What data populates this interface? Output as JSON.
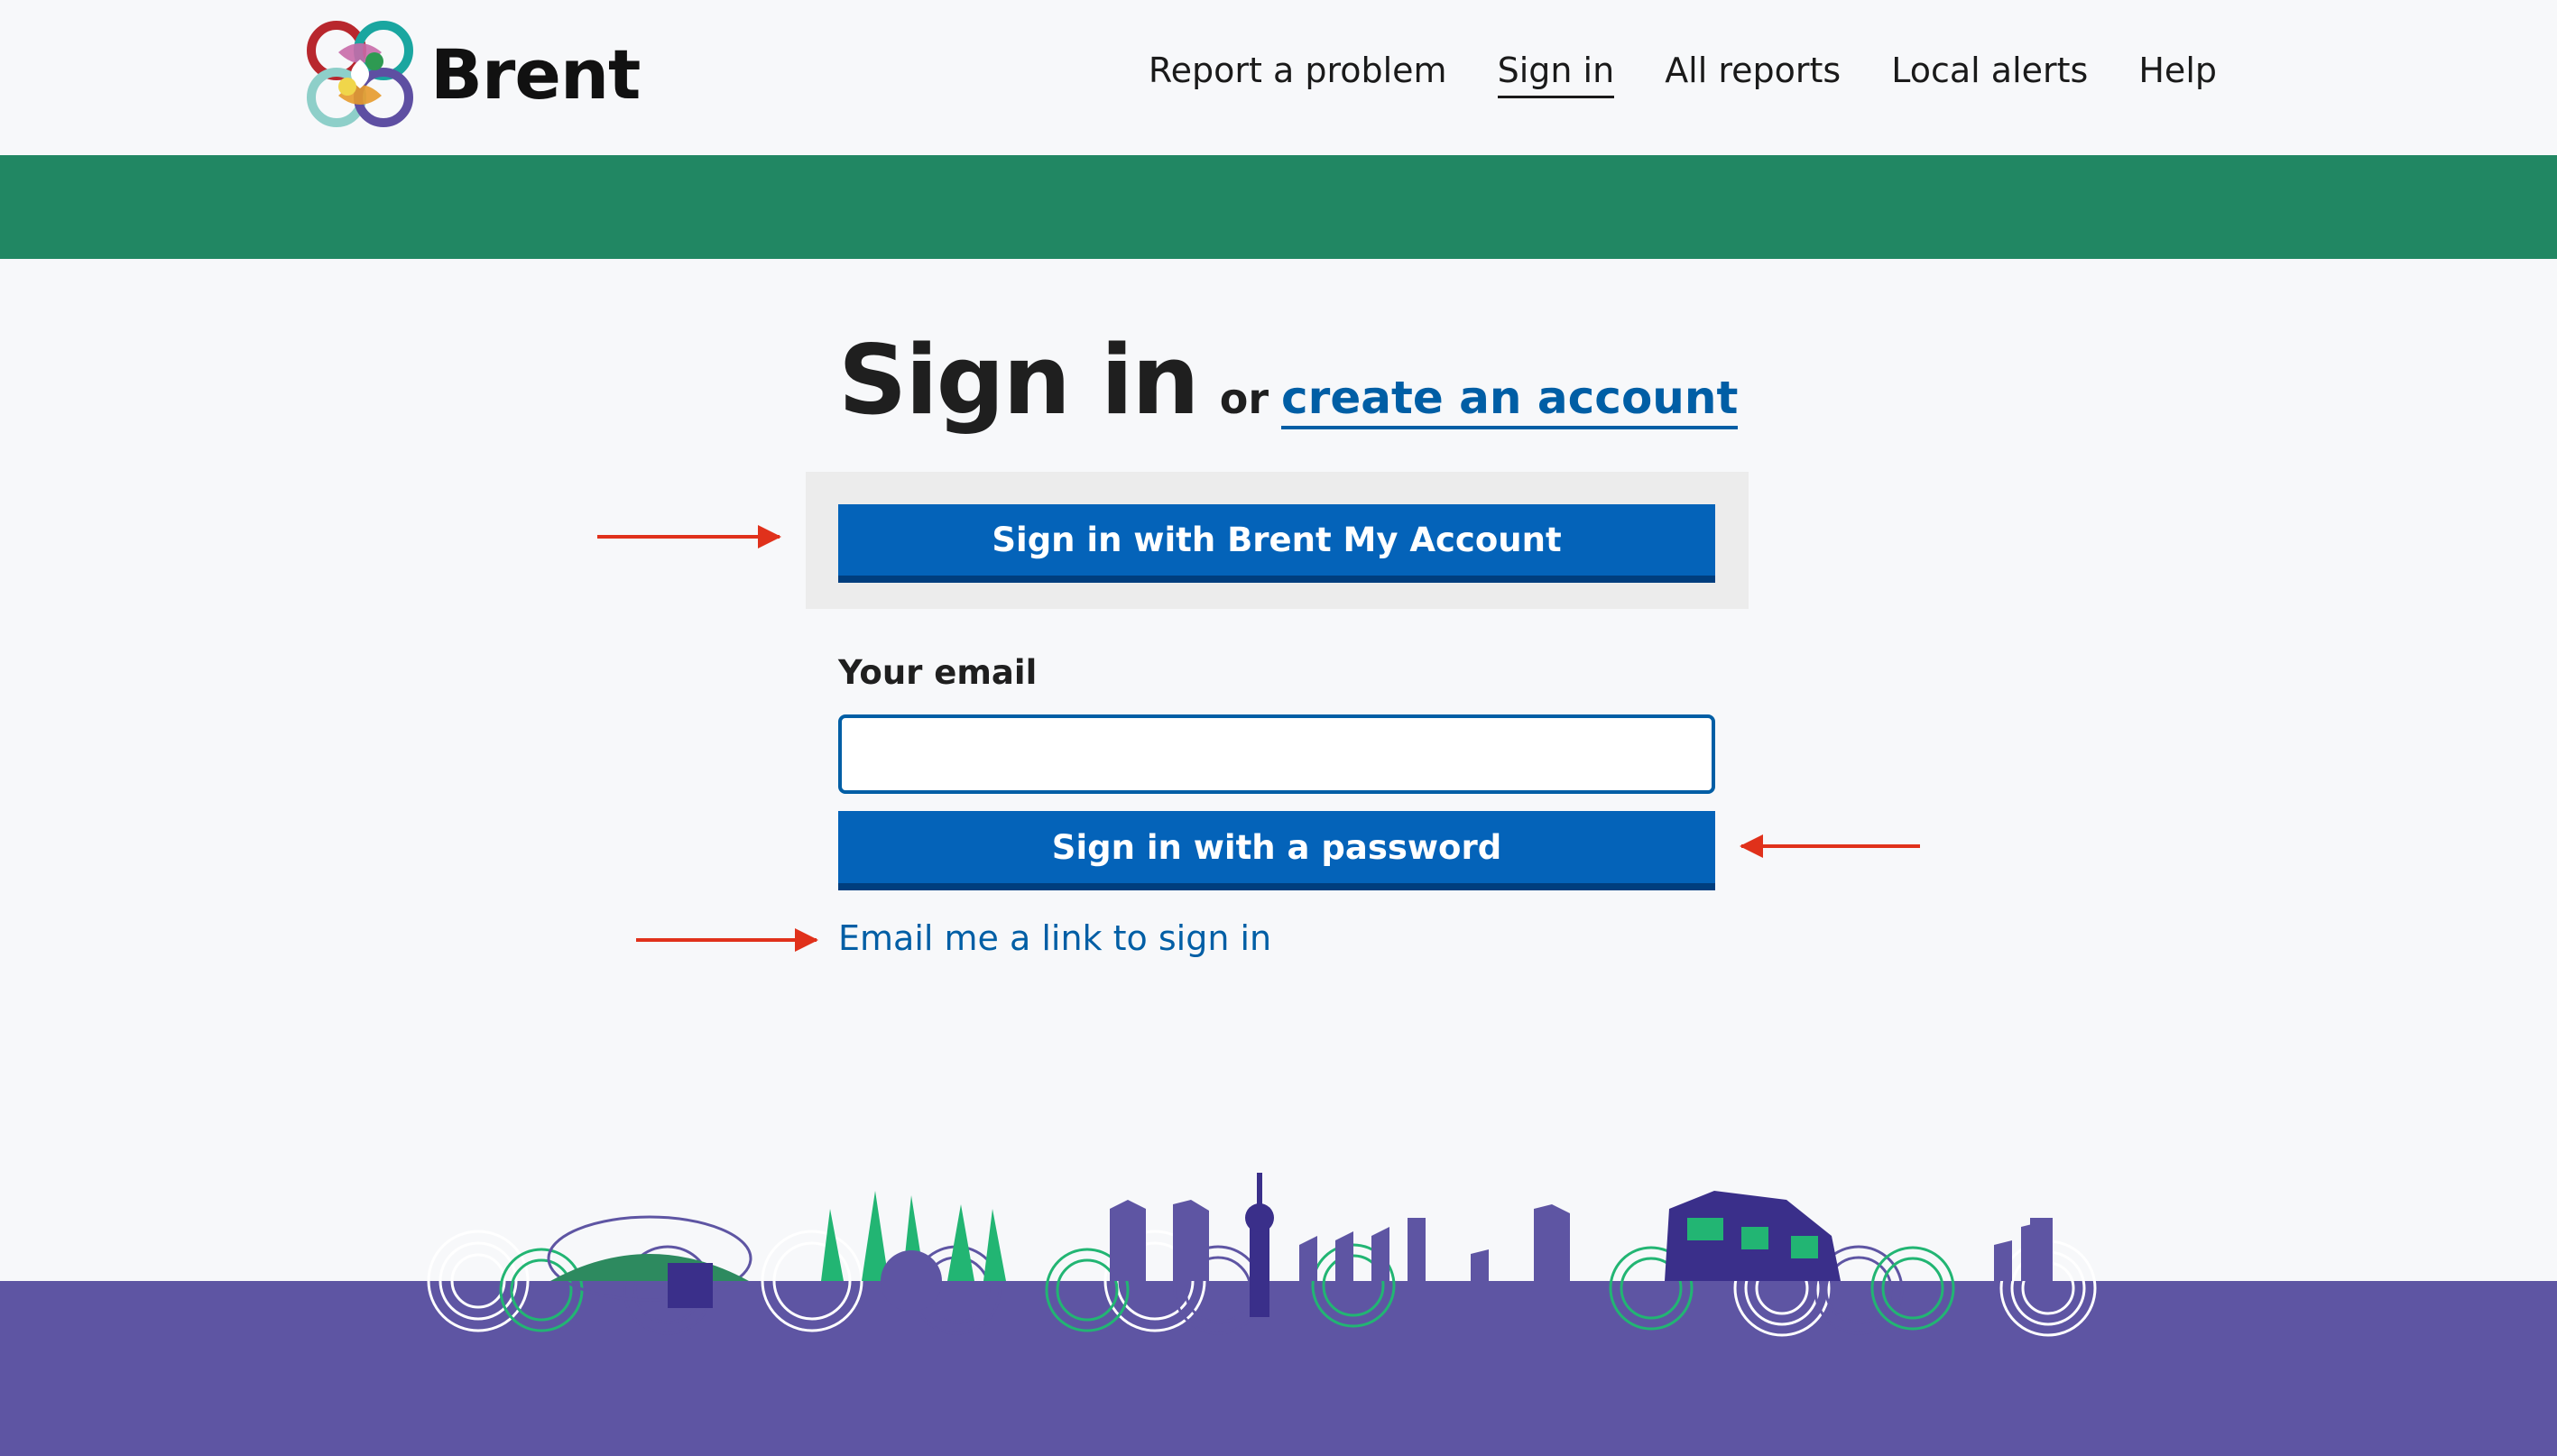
{
  "header": {
    "logo_text": "Brent",
    "nav": [
      {
        "label": "Report a problem"
      },
      {
        "label": "Sign in",
        "active": true
      },
      {
        "label": "All reports"
      },
      {
        "label": "Local alerts"
      },
      {
        "label": "Help"
      }
    ]
  },
  "main": {
    "title": "Sign in",
    "or_text": "or",
    "create_account_link": "create an account",
    "my_account_button": "Sign in with Brent My Account",
    "email_label": "Your email",
    "email_value": "",
    "password_button": "Sign in with a password",
    "email_link": "Email me a link to sign in"
  },
  "colors": {
    "accent_green": "#218763",
    "primary_blue": "#0463b9",
    "link_blue": "#005ea5",
    "footer_purple": "#5e55a3",
    "annotation_red": "#e0311b"
  },
  "icons": [
    "brent-logo-icon",
    "annotation-arrow",
    "skyline-illustration"
  ]
}
